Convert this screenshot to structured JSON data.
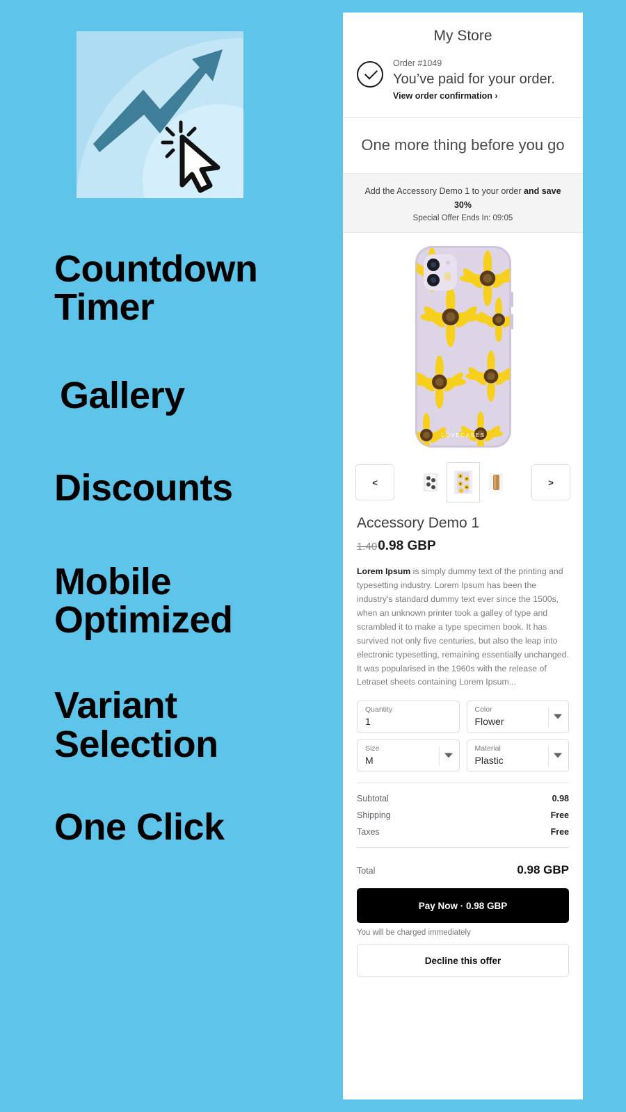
{
  "theme": {
    "background": "#5fc4ea",
    "panel_bg": "#ffffff",
    "logo_panel": "#aedcf2",
    "accent_dark": "#000000",
    "offer_band_bg": "#f4f4f4"
  },
  "promo": {
    "logo_icon": "growth-arrow-click-icon",
    "features": [
      {
        "id": "countdown-timer",
        "label": "Countdown\nTimer"
      },
      {
        "id": "gallery",
        "label": "Gallery"
      },
      {
        "id": "discounts",
        "label": "Discounts"
      },
      {
        "id": "mobile-optimized",
        "label": "Mobile\nOptimized"
      },
      {
        "id": "variant-selection",
        "label": "Variant\nSelection"
      },
      {
        "id": "one-click",
        "label": "One Click"
      }
    ]
  },
  "checkout": {
    "store_title": "My Store",
    "order": {
      "number_label": "Order #1049",
      "status": "You’ve paid for your order.",
      "confirmation_link": "View order confirmation ›",
      "status_icon": "check-circle-icon"
    },
    "upsell_heading": "One more thing before you go",
    "offer": {
      "text_before": "Add the Accessory Demo 1 to your order ",
      "text_bold": "and save 30%",
      "timer_label": "Special Offer Ends In: 09:05"
    },
    "gallery": {
      "prev_label": "<",
      "next_label": ">",
      "thumbs": [
        {
          "id": "thumb-1",
          "icon": "grayscale-case-thumb",
          "selected": false
        },
        {
          "id": "thumb-2",
          "icon": "sunflower-case-thumb",
          "selected": true
        },
        {
          "id": "thumb-3",
          "icon": "tan-case-thumb",
          "selected": false
        }
      ],
      "hero_icon": "sunflower-phone-case-image",
      "hero_brand": "LOVECASES"
    },
    "product": {
      "title": "Accessory Demo 1",
      "price_old": "1.40",
      "price_new": "0.98 GBP",
      "description_bold": "Lorem Ipsum",
      "description_rest": " is simply dummy text of the printing and typesetting industry. Lorem Ipsum has been the industry's standard dummy text ever since the 1500s, when an unknown printer took a galley of type and scrambled it to make a type specimen book. It has survived not only five centuries, but also the leap into electronic typesetting, remaining essentially unchanged. It was popularised in the 1960s with the release of Letraset sheets containing Lorem Ipsum..."
    },
    "variants": [
      {
        "id": "quantity",
        "label": "Quantity",
        "value": "1",
        "has_caret": false
      },
      {
        "id": "color",
        "label": "Color",
        "value": "Flower",
        "has_caret": true
      },
      {
        "id": "size",
        "label": "Size",
        "value": "M",
        "has_caret": true
      },
      {
        "id": "material",
        "label": "Material",
        "value": "Plastic",
        "has_caret": true
      }
    ],
    "totals": {
      "rows": [
        {
          "label": "Subtotal",
          "value": "0.98"
        },
        {
          "label": "Shipping",
          "value": "Free"
        },
        {
          "label": "Taxes",
          "value": "Free"
        }
      ],
      "total_label": "Total",
      "total_value": "0.98 GBP"
    },
    "actions": {
      "pay_label": "Pay Now · 0.98 GBP",
      "charge_note": "You will be charged immediately",
      "decline_label": "Decline this offer"
    }
  }
}
